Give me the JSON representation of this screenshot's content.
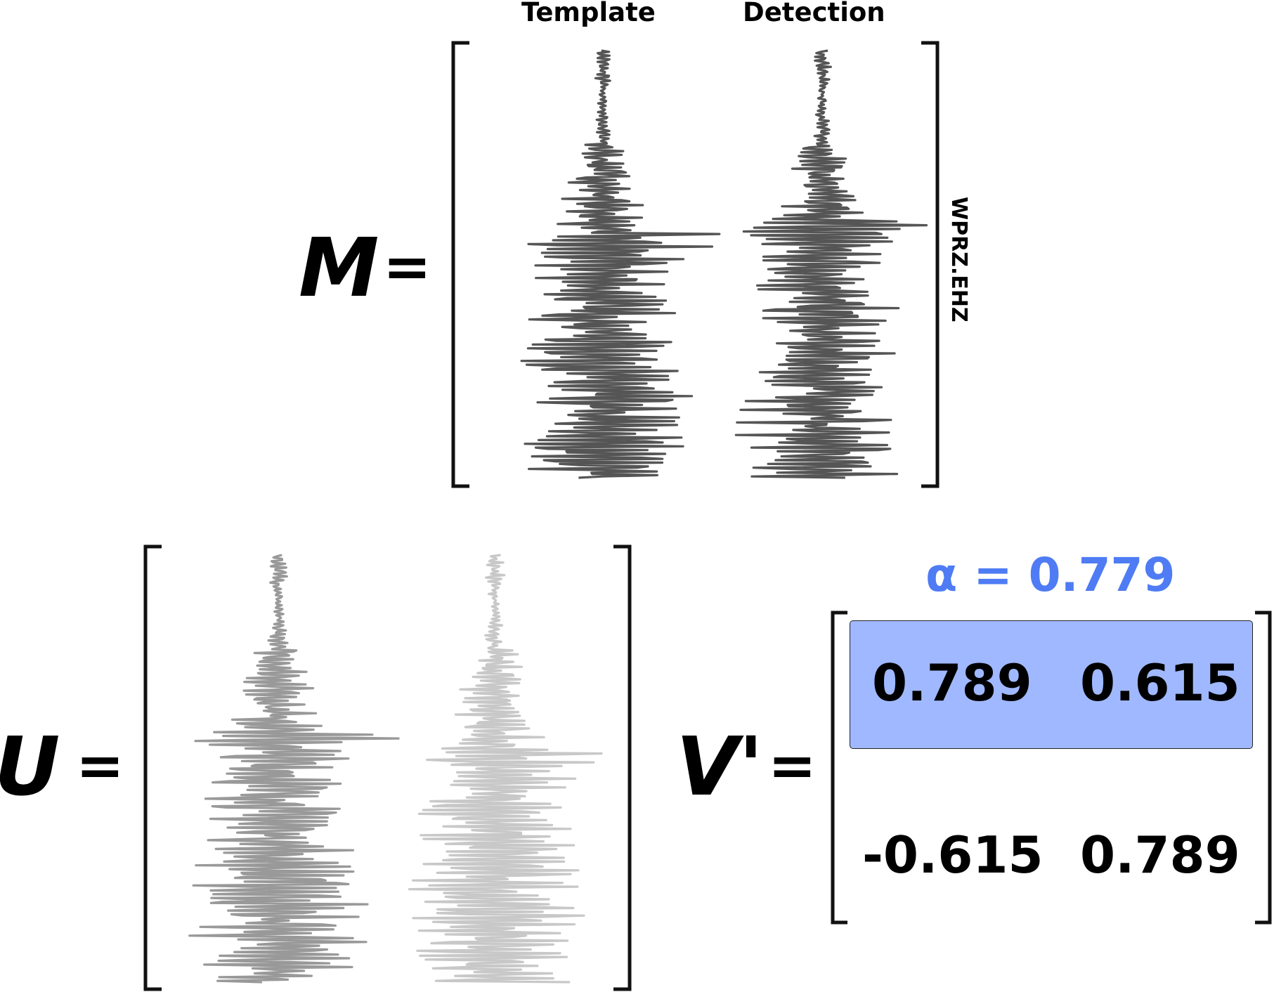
{
  "top": {
    "columns": [
      "Template",
      "Detection"
    ],
    "symbol": "M",
    "equals": "=",
    "station": "WPRZ.EHZ",
    "trace_color": "#555555"
  },
  "bottom_left": {
    "symbol": "U",
    "equals": "=",
    "trace_colors": [
      "#999999",
      "#c8c8c8"
    ]
  },
  "bottom_right": {
    "symbol": "V'",
    "equals": "=",
    "alpha": "α = 0.779",
    "alpha_color": "#4f7cf4",
    "highlight_color": "#a0b8ff",
    "rows": [
      [
        "0.789",
        "0.615"
      ],
      [
        "-0.615",
        "0.789"
      ]
    ]
  }
}
